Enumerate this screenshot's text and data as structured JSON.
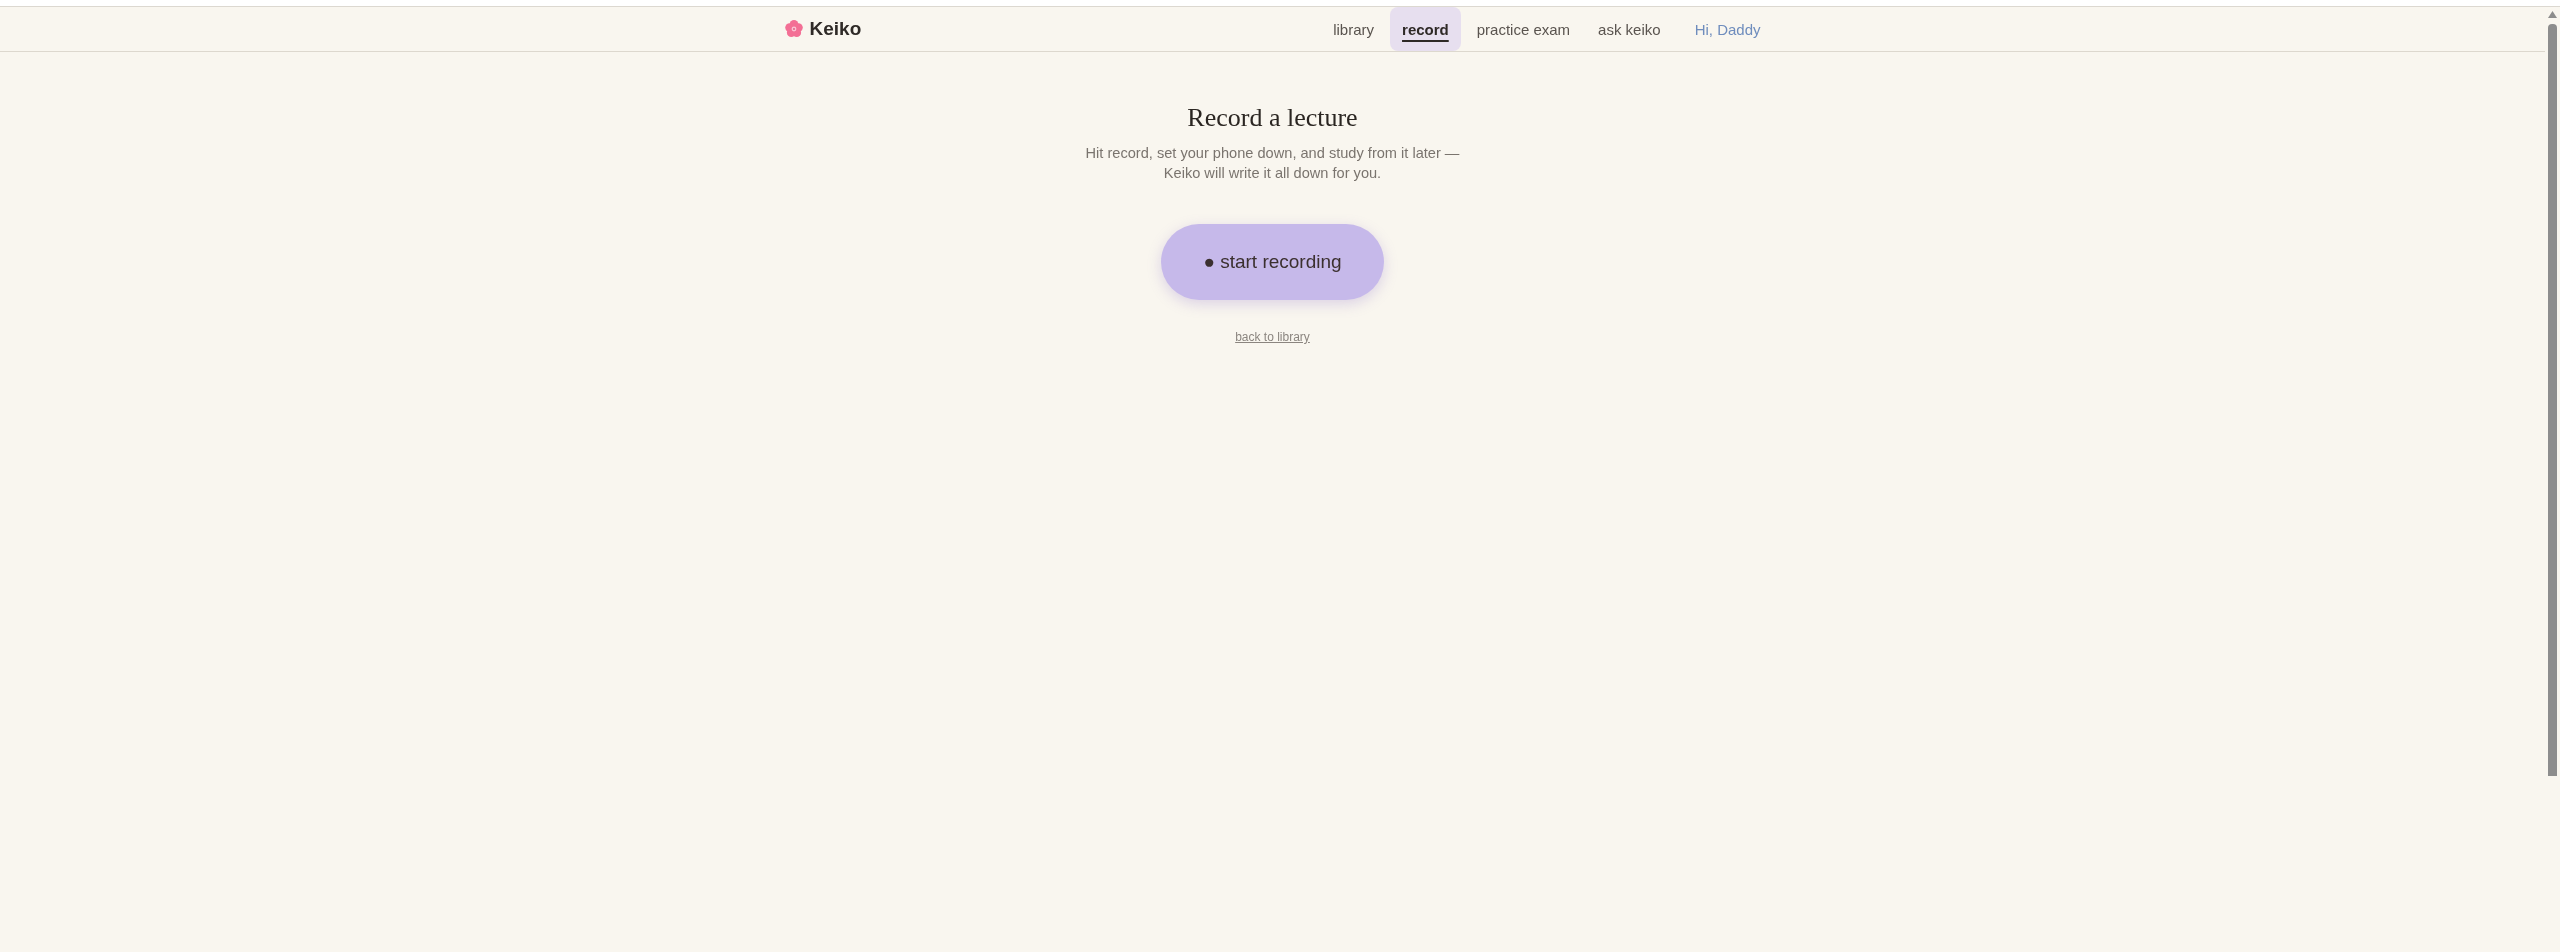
{
  "header": {
    "brand": "Keiko",
    "nav": [
      {
        "label": "library",
        "selected": false
      },
      {
        "label": "record",
        "selected": true
      },
      {
        "label": "practice exam",
        "selected": false
      },
      {
        "label": "ask keiko",
        "selected": false
      }
    ],
    "greeting": "Hi, Daddy"
  },
  "main": {
    "title": "Record a lecture",
    "subtitle_lines": [
      "Hit record, set your phone down, and study from it later —",
      "Keiko will write it all down for you."
    ],
    "record_button": "● start recording",
    "back_link": "back to library"
  }
}
